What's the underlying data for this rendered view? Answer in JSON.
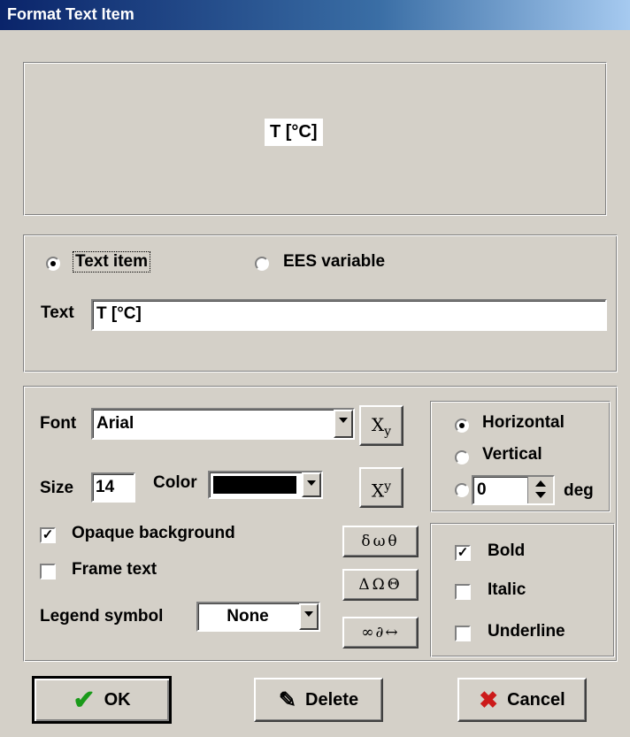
{
  "window": {
    "title": "Format Text Item"
  },
  "preview": {
    "text": "T [°C]"
  },
  "source": {
    "text_item_label": "Text item",
    "ees_variable_label": "EES variable",
    "selected": "text_item",
    "text_label": "Text",
    "text_value": "T [°C]"
  },
  "format": {
    "font_label": "Font",
    "font_value": "Arial",
    "size_label": "Size",
    "size_value": "14",
    "color_label": "Color",
    "color_value": "#000000",
    "subscript_label": "X",
    "subscript_sub": "y",
    "superscript_label": "X",
    "superscript_sup": "y",
    "opaque_background_label": "Opaque background",
    "opaque_background_checked": true,
    "frame_text_label": "Frame text",
    "frame_text_checked": false,
    "legend_symbol_label": "Legend symbol",
    "legend_symbol_value": "None",
    "symbols_lower": "δωθ",
    "symbols_upper": "ΔΩΘ",
    "symbols_math": "∞∂↔"
  },
  "orientation": {
    "horizontal_label": "Horizontal",
    "vertical_label": "Vertical",
    "angle_value": "0",
    "deg_label": "deg",
    "selected": "horizontal"
  },
  "style": {
    "bold_label": "Bold",
    "bold_checked": true,
    "italic_label": "Italic",
    "italic_checked": false,
    "underline_label": "Underline",
    "underline_checked": false
  },
  "buttons": {
    "ok_label": "OK",
    "delete_label": "Delete",
    "cancel_label": "Cancel"
  },
  "colors": {
    "title_bar": "#0a246a",
    "dialog": "#d4d0c8",
    "ok_check": "#1a9a1a",
    "cancel_x": "#cc1a1a"
  }
}
